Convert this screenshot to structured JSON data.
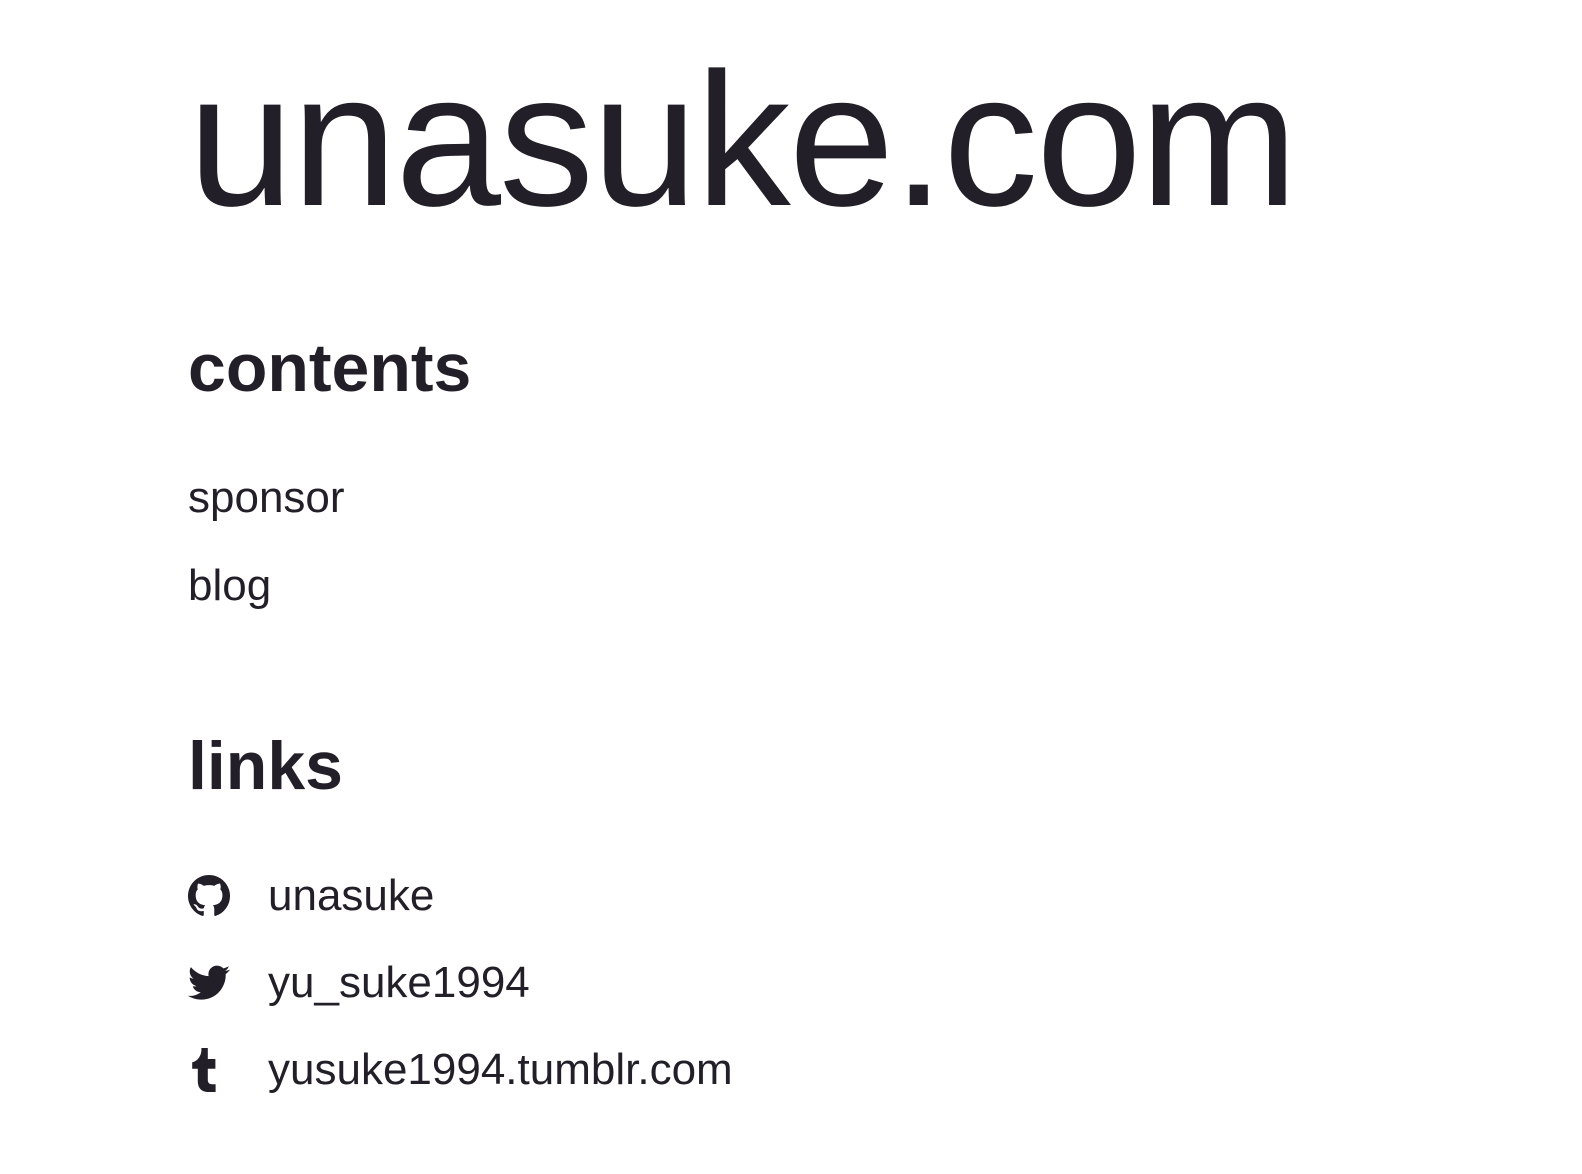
{
  "site": {
    "title": "unasuke.com"
  },
  "contents": {
    "heading": "contents",
    "items": [
      {
        "label": "sponsor"
      },
      {
        "label": "blog"
      }
    ]
  },
  "links": {
    "heading": "links",
    "items": [
      {
        "icon": "github-icon",
        "label": "unasuke"
      },
      {
        "icon": "twitter-icon",
        "label": "yu_suke1994"
      },
      {
        "icon": "tumblr-icon",
        "label": "yusuke1994.tumblr.com"
      }
    ]
  },
  "colors": {
    "text": "#221f28",
    "background": "#ffffff"
  }
}
